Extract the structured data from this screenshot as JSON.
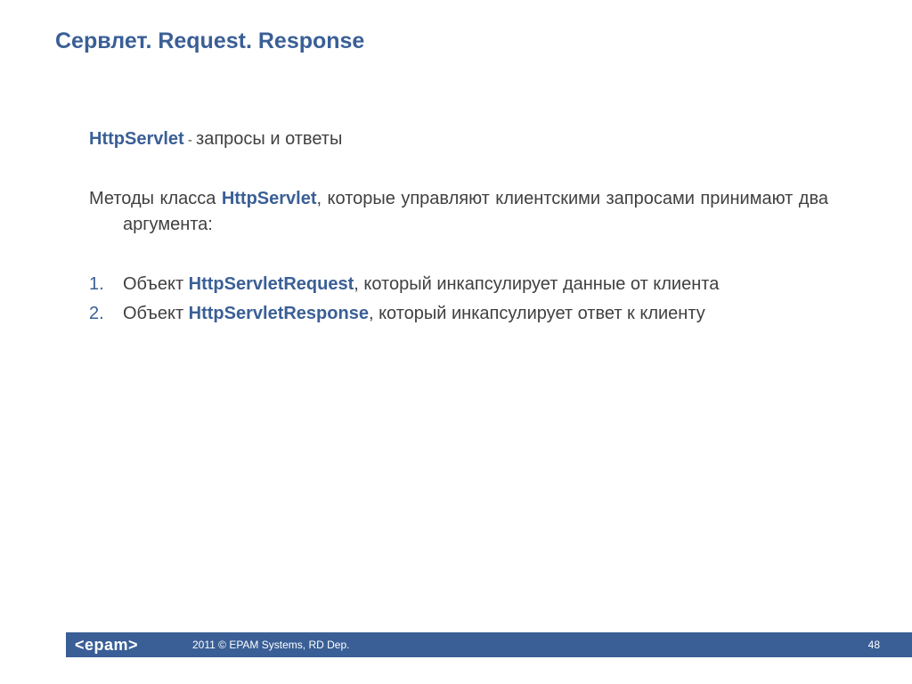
{
  "title": "Сервлет. Request. Response",
  "line1": {
    "kw": "HttpServlet",
    "dash": " - ",
    "rest": "запросы и ответы"
  },
  "para2": {
    "pre": "Методы класса ",
    "kw": "HttpServlet",
    "post": ", которые управляют клиентскими запросами принимают два аргумента:"
  },
  "list": [
    {
      "pre": "Объект ",
      "kw": "HttpServletRequest",
      "post": ", который инкапсулирует данные от клиента"
    },
    {
      "pre": "Объект ",
      "kw": "HttpServletResponse",
      "post": ", который инкапсулирует ответ к клиенту"
    }
  ],
  "footer": {
    "logo": "<epam>",
    "copyright": "2011 © EPAM Systems, RD Dep.",
    "page": "48"
  }
}
